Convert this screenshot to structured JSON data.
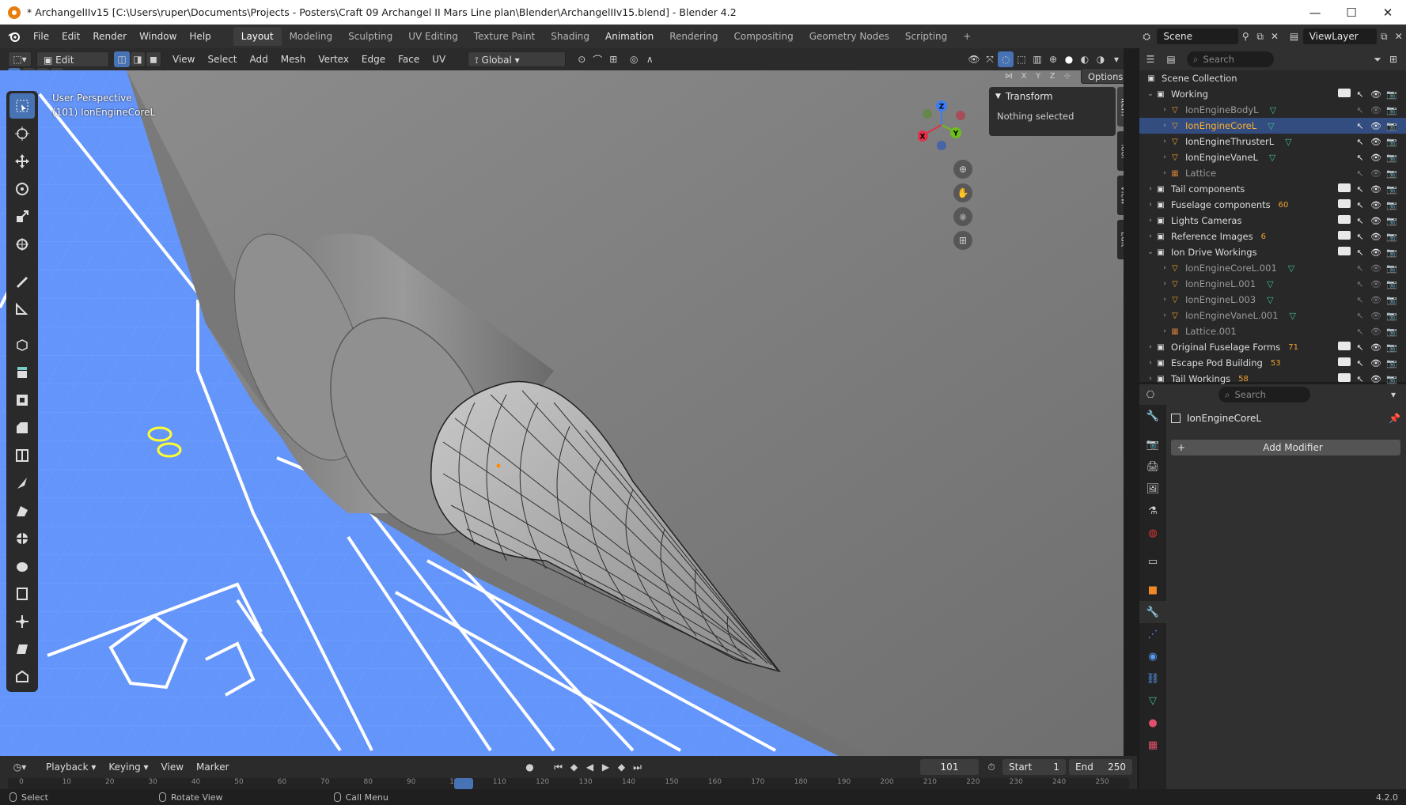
{
  "titlebar": {
    "title": "* ArchangelIIv15 [C:\\Users\\ruper\\Documents\\Projects - Posters\\Craft 09 Archangel II Mars Line plan\\Blender\\ArchangelIIv15.blend] - Blender 4.2",
    "minimize": "—",
    "maximize": "☐",
    "close": "✕"
  },
  "menubar": {
    "menus": [
      "File",
      "Edit",
      "Render",
      "Window",
      "Help"
    ],
    "workspaces": [
      "Layout",
      "Modeling",
      "Sculpting",
      "UV Editing",
      "Texture Paint",
      "Shading",
      "Animation",
      "Rendering",
      "Compositing",
      "Geometry Nodes",
      "Scripting"
    ],
    "active_workspace": "Layout",
    "add_tab": "+",
    "scene_label": "Scene",
    "viewlayer_label": "ViewLayer"
  },
  "viewport_header": {
    "mode": "Edit Mode",
    "menus": [
      "View",
      "Select",
      "Add",
      "Mesh",
      "Vertex",
      "Edge",
      "Face",
      "UV"
    ],
    "transform_orientation": "Global",
    "options_label": "Options",
    "axes": [
      "X",
      "Y",
      "Z"
    ],
    "search_placeholder": "Search"
  },
  "viewport": {
    "perspective_label": "User Perspective",
    "object_label": "(101) IonEngineCoreL",
    "nav_gizmo": {
      "x": "X",
      "y": "Y",
      "z": "Z"
    },
    "colors": {
      "background": "#6495fa",
      "selected": "#4772b3",
      "active_text": "#ffaf29"
    }
  },
  "npanel": {
    "section": "Transform",
    "message": "Nothing selected",
    "tabs": [
      "Item",
      "Tool",
      "View",
      "Edit"
    ],
    "active_tab": "Item"
  },
  "outliner": {
    "root": "Scene Collection",
    "rows": [
      {
        "depth": 1,
        "type": "collection",
        "name": "Working",
        "expanded": true
      },
      {
        "depth": 2,
        "type": "mesh",
        "name": "IonEngineBodyL",
        "dim": true
      },
      {
        "depth": 2,
        "type": "mesh",
        "name": "IonEngineCoreL",
        "selected": true,
        "active": true
      },
      {
        "depth": 2,
        "type": "mesh",
        "name": "IonEngineThrusterL"
      },
      {
        "depth": 2,
        "type": "mesh",
        "name": "IonEngineVaneL"
      },
      {
        "depth": 2,
        "type": "lattice",
        "name": "Lattice",
        "dim": true
      },
      {
        "depth": 1,
        "type": "collection",
        "name": "Tail components"
      },
      {
        "depth": 1,
        "type": "collection",
        "name": "Fuselage components",
        "badge": "60"
      },
      {
        "depth": 1,
        "type": "collection",
        "name": "Lights Cameras"
      },
      {
        "depth": 1,
        "type": "collection",
        "name": "Reference Images",
        "badge": "6"
      },
      {
        "depth": 1,
        "type": "collection",
        "name": "Ion Drive Workings",
        "expanded": true
      },
      {
        "depth": 2,
        "type": "mesh",
        "name": "IonEngineCoreL.001",
        "dim": true
      },
      {
        "depth": 2,
        "type": "mesh",
        "name": "IonEngineL.001",
        "dim": true
      },
      {
        "depth": 2,
        "type": "mesh",
        "name": "IonEngineL.003",
        "dim": true
      },
      {
        "depth": 2,
        "type": "mesh",
        "name": "IonEngineVaneL.001",
        "dim": true
      },
      {
        "depth": 2,
        "type": "lattice",
        "name": "Lattice.001",
        "dim": true
      },
      {
        "depth": 1,
        "type": "collection",
        "name": "Original Fuselage Forms",
        "badge": "71"
      },
      {
        "depth": 1,
        "type": "collection",
        "name": "Escape Pod Building",
        "badge": "53"
      },
      {
        "depth": 1,
        "type": "collection",
        "name": "Tail Workings",
        "badge": "58"
      }
    ]
  },
  "properties": {
    "search_placeholder": "Search",
    "object_name": "IonEngineCoreL",
    "add_modifier": "Add Modifier"
  },
  "timeline": {
    "menus": [
      "Playback",
      "Keying",
      "View",
      "Marker"
    ],
    "current_frame": "101",
    "start_label": "Start",
    "start": "1",
    "end_label": "End",
    "end": "250",
    "ruler_ticks": [
      "0",
      "10",
      "20",
      "30",
      "40",
      "50",
      "60",
      "70",
      "80",
      "90",
      "100",
      "110",
      "120",
      "130",
      "140",
      "150",
      "160",
      "170",
      "180",
      "190",
      "200",
      "210",
      "220",
      "230",
      "240",
      "250"
    ]
  },
  "statusbar": {
    "select": "Select",
    "rotate_view": "Rotate View",
    "call_menu": "Call Menu",
    "version": "4.2.0"
  }
}
